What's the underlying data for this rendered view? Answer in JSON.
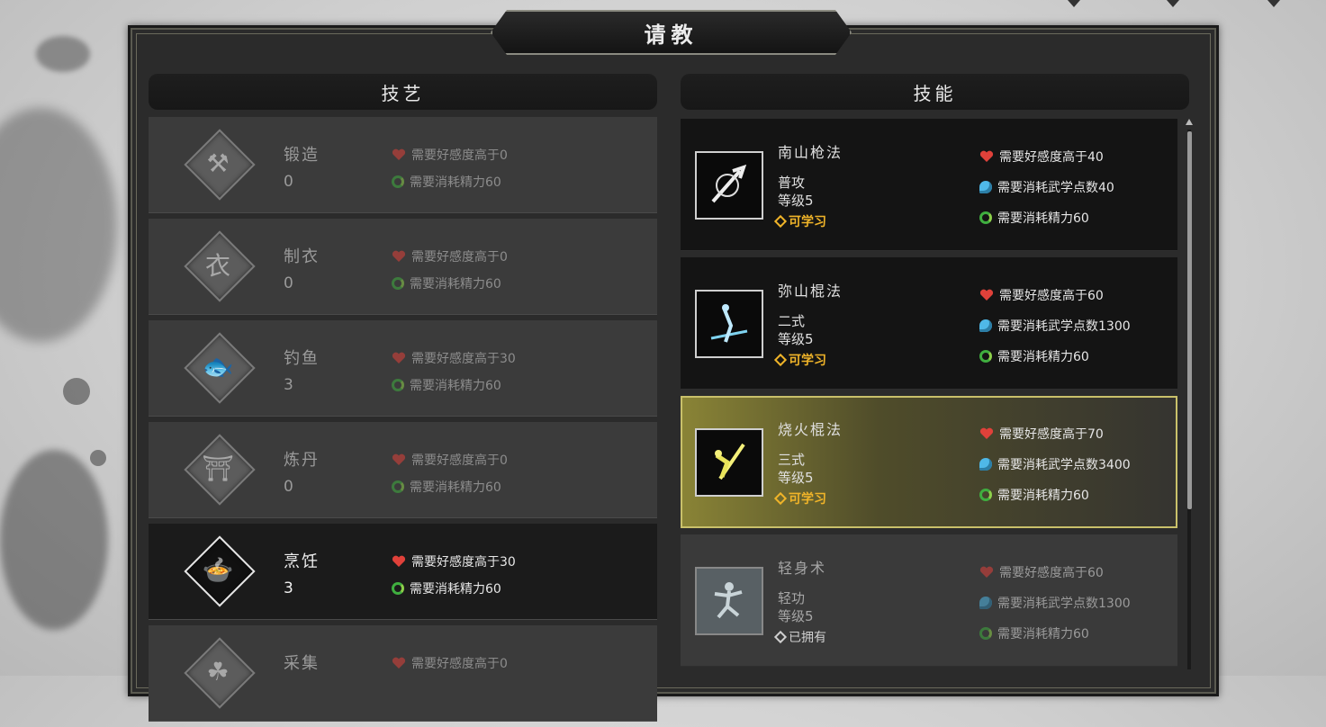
{
  "dialog": {
    "title": "请教"
  },
  "left_panel": {
    "header": "技艺",
    "items": [
      {
        "name": "锻造",
        "level": "0",
        "req_favor": "需要好感度高于0",
        "req_stamina": "需要消耗精力60",
        "icon": "anvil-icon",
        "active": false
      },
      {
        "name": "制衣",
        "level": "0",
        "req_favor": "需要好感度高于0",
        "req_stamina": "需要消耗精力60",
        "icon": "clothing-icon",
        "active": false
      },
      {
        "name": "钓鱼",
        "level": "3",
        "req_favor": "需要好感度高于30",
        "req_stamina": "需要消耗精力60",
        "icon": "fish-icon",
        "active": false
      },
      {
        "name": "炼丹",
        "level": "0",
        "req_favor": "需要好感度高于0",
        "req_stamina": "需要消耗精力60",
        "icon": "furnace-icon",
        "active": false
      },
      {
        "name": "烹饪",
        "level": "3",
        "req_favor": "需要好感度高于30",
        "req_stamina": "需要消耗精力60",
        "icon": "cooking-bowl-icon",
        "active": true
      },
      {
        "name": "采集",
        "level": "",
        "req_favor": "需要好感度高于0",
        "req_stamina": "",
        "icon": "herb-icon",
        "active": false
      }
    ]
  },
  "right_panel": {
    "header": "技能",
    "items": [
      {
        "name": "南山枪法",
        "type": "普攻",
        "level": "等级5",
        "status": "可学习",
        "req_favor": "需要好感度高于40",
        "req_points": "需要消耗武学点数40",
        "req_stamina": "需要消耗精力60",
        "icon": "spear-skill-icon",
        "state": "learnable"
      },
      {
        "name": "弥山棍法",
        "type": "二式",
        "level": "等级5",
        "status": "可学习",
        "req_favor": "需要好感度高于60",
        "req_points": "需要消耗武学点数1300",
        "req_stamina": "需要消耗精力60",
        "icon": "staff-skill-icon",
        "state": "learnable"
      },
      {
        "name": "烧火棍法",
        "type": "三式",
        "level": "等级5",
        "status": "可学习",
        "req_favor": "需要好感度高于70",
        "req_points": "需要消耗武学点数3400",
        "req_stamina": "需要消耗精力60",
        "icon": "fire-staff-skill-icon",
        "state": "selected"
      },
      {
        "name": "轻身术",
        "type": "轻功",
        "level": "等级5",
        "status": "已拥有",
        "req_favor": "需要好感度高于60",
        "req_points": "需要消耗武学点数1300",
        "req_stamina": "需要消耗精力60",
        "icon": "lightness-skill-icon",
        "state": "owned"
      }
    ]
  },
  "colors": {
    "learnable": "#f0b429",
    "selected_highlight": "#c9c06a",
    "favor_heart": "#e0413a",
    "stamina": "#3fae3f",
    "points": "#4fb8e8"
  }
}
